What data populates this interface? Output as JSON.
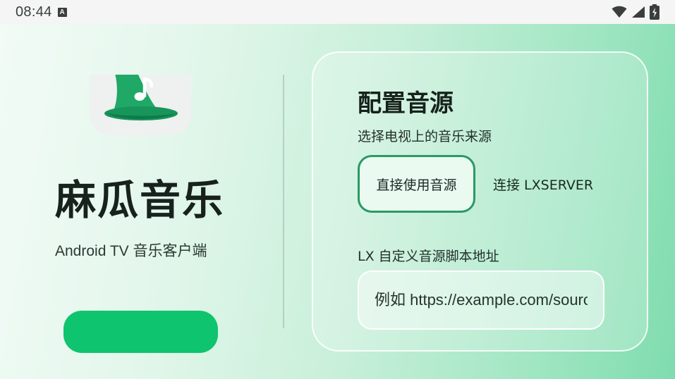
{
  "status_bar": {
    "time": "08:44",
    "notification_icon": "a-notification-icon",
    "icons": [
      "wifi-icon",
      "signal-icon",
      "battery-charging-icon"
    ]
  },
  "app": {
    "name": "麻瓜音乐",
    "subtitle": "Android TV 音乐客户端",
    "logo_icon": "wizard-hat-music-note-icon",
    "accent_color": "#0fc46e",
    "primary_button_label": ""
  },
  "settings": {
    "title": "配置音源",
    "description": "选择电视上的音乐来源",
    "options": [
      {
        "label": "直接使用音源",
        "selected": true
      },
      {
        "label": "连接 LXSERVER",
        "selected": false
      }
    ],
    "script_url": {
      "label": "LX 自定义音源脚本地址",
      "value": "",
      "placeholder": "例如 https://example.com/source.js"
    }
  }
}
